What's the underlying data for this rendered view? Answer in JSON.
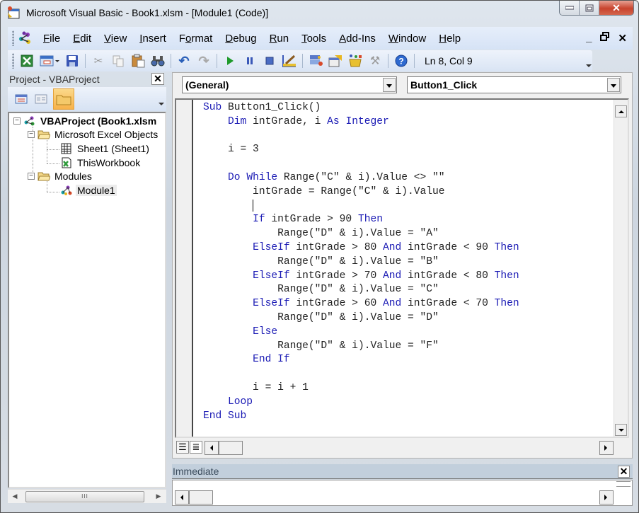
{
  "window": {
    "title_prefix": "Microsoft Visual Basic - Book1.xlsm - ",
    "title_doc": "[Module1 (Code)]",
    "minimize": "—",
    "maximize": "▢",
    "close": "✕"
  },
  "menu": {
    "items": [
      {
        "label": "File",
        "accel": "F"
      },
      {
        "label": "Edit",
        "accel": "E"
      },
      {
        "label": "View",
        "accel": "V"
      },
      {
        "label": "Insert",
        "accel": "I"
      },
      {
        "label": "Format",
        "accel": "o"
      },
      {
        "label": "Debug",
        "accel": "D"
      },
      {
        "label": "Run",
        "accel": "R"
      },
      {
        "label": "Tools",
        "accel": "T"
      },
      {
        "label": "Add-Ins",
        "accel": "A"
      },
      {
        "label": "Window",
        "accel": "W"
      },
      {
        "label": "Help",
        "accel": "H"
      }
    ],
    "mdi_minimize": "_",
    "mdi_restore": "🗗",
    "mdi_close": "✕"
  },
  "toolbar": {
    "icons": [
      "view-excel-icon",
      "insert-userform-icon",
      "save-icon",
      "cut-icon",
      "copy-icon",
      "paste-icon",
      "find-icon",
      "undo-icon",
      "redo-icon",
      "run-icon",
      "break-icon",
      "reset-icon",
      "design-mode-icon",
      "project-explorer-icon",
      "properties-icon",
      "object-browser-icon",
      "toolbox-icon",
      "help-icon"
    ],
    "status": "Ln 8, Col 9"
  },
  "project": {
    "title": "Project - VBAProject",
    "close": "✕",
    "tree": [
      {
        "label": "VBAProject (Book1.xlsm",
        "level": 0,
        "type": "project",
        "expanded": true
      },
      {
        "label": "Microsoft Excel Objects",
        "level": 1,
        "type": "folder",
        "expanded": true
      },
      {
        "label": "Sheet1 (Sheet1)",
        "level": 2,
        "type": "sheet"
      },
      {
        "label": "ThisWorkbook",
        "level": 2,
        "type": "workbook"
      },
      {
        "label": "Modules",
        "level": 1,
        "type": "folder",
        "expanded": true
      },
      {
        "label": "Module1",
        "level": 2,
        "type": "module",
        "selected": true
      }
    ],
    "scroll_thumb": "III"
  },
  "code": {
    "object_combo": "(General)",
    "procedure_combo": "Button1_Click",
    "lines": [
      [
        {
          "t": "Sub",
          "k": true
        },
        {
          "t": " Button1_Click()"
        }
      ],
      [
        {
          "t": "    "
        },
        {
          "t": "Dim",
          "k": true
        },
        {
          "t": " intGrade, i "
        },
        {
          "t": "As",
          "k": true
        },
        {
          "t": " "
        },
        {
          "t": "Integer",
          "k": true
        }
      ],
      [],
      [
        {
          "t": "    i = 3"
        }
      ],
      [],
      [
        {
          "t": "    "
        },
        {
          "t": "Do",
          "k": true
        },
        {
          "t": " "
        },
        {
          "t": "While",
          "k": true
        },
        {
          "t": " Range(\"C\" & i).Value <> \"\""
        }
      ],
      [
        {
          "t": "        intGrade = Range(\"C\" & i).Value"
        }
      ],
      [
        {
          "t": "        "
        },
        {
          "caret": true
        }
      ],
      [
        {
          "t": "        "
        },
        {
          "t": "If",
          "k": true
        },
        {
          "t": " intGrade > 90 "
        },
        {
          "t": "Then",
          "k": true
        }
      ],
      [
        {
          "t": "            Range(\"D\" & i).Value = \"A\""
        }
      ],
      [
        {
          "t": "        "
        },
        {
          "t": "ElseIf",
          "k": true
        },
        {
          "t": " intGrade > 80 "
        },
        {
          "t": "And",
          "k": true
        },
        {
          "t": " intGrade < 90 "
        },
        {
          "t": "Then",
          "k": true
        }
      ],
      [
        {
          "t": "            Range(\"D\" & i).Value = \"B\""
        }
      ],
      [
        {
          "t": "        "
        },
        {
          "t": "ElseIf",
          "k": true
        },
        {
          "t": " intGrade > 70 "
        },
        {
          "t": "And",
          "k": true
        },
        {
          "t": " intGrade < 80 "
        },
        {
          "t": "Then",
          "k": true
        }
      ],
      [
        {
          "t": "            Range(\"D\" & i).Value = \"C\""
        }
      ],
      [
        {
          "t": "        "
        },
        {
          "t": "ElseIf",
          "k": true
        },
        {
          "t": " intGrade > 60 "
        },
        {
          "t": "And",
          "k": true
        },
        {
          "t": " intGrade < 70 "
        },
        {
          "t": "Then",
          "k": true
        }
      ],
      [
        {
          "t": "            Range(\"D\" & i).Value = \"D\""
        }
      ],
      [
        {
          "t": "        "
        },
        {
          "t": "Else",
          "k": true
        }
      ],
      [
        {
          "t": "            Range(\"D\" & i).Value = \"F\""
        }
      ],
      [
        {
          "t": "        "
        },
        {
          "t": "End",
          "k": true
        },
        {
          "t": " "
        },
        {
          "t": "If",
          "k": true
        }
      ],
      [],
      [
        {
          "t": "        i = i + 1"
        }
      ],
      [
        {
          "t": "    "
        },
        {
          "t": "Loop",
          "k": true
        }
      ],
      [
        {
          "t": "End",
          "k": true
        },
        {
          "t": " "
        },
        {
          "t": "Sub",
          "k": true
        }
      ]
    ],
    "procedure_view": "☰",
    "full_module_view": "≣"
  },
  "immediate": {
    "title": "Immediate",
    "close": "✕"
  },
  "colors": {
    "keyword": "#1a1ab4",
    "menu_bg": "#dce7f7",
    "immediate_title_bg": "#c2cfdc"
  }
}
